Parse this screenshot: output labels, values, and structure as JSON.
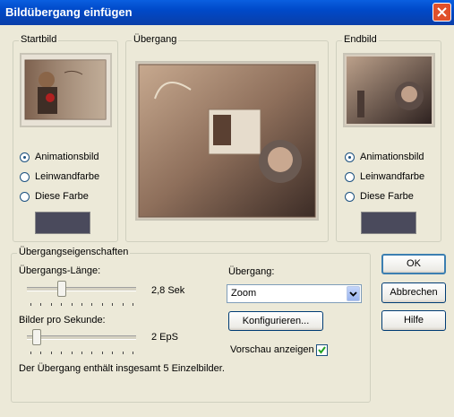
{
  "dialog": {
    "title": "Bildübergang einfügen"
  },
  "startbild": {
    "legend": "Startbild",
    "preview_alt": "Startbild-Vorschau",
    "options": [
      {
        "label": "Animationsbild",
        "selected": true
      },
      {
        "label": "Leinwandfarbe",
        "selected": false
      },
      {
        "label": "Diese Farbe",
        "selected": false
      }
    ],
    "color": "#4A4A5C"
  },
  "uebergang_preview": {
    "legend": "Übergang",
    "preview_alt": "Übergangs-Vorschau"
  },
  "endbild": {
    "legend": "Endbild",
    "preview_alt": "Endbild-Vorschau",
    "options": [
      {
        "label": "Animationsbild",
        "selected": true
      },
      {
        "label": "Leinwandfarbe",
        "selected": false
      },
      {
        "label": "Diese Farbe",
        "selected": false
      }
    ],
    "color": "#4A4A5C"
  },
  "properties": {
    "legend": "Übergangseigenschaften",
    "length_label": "Übergangs-Länge:",
    "length_value": "2,8 Sek",
    "length_fraction": 0.3,
    "fps_label": "Bilder pro Sekunde:",
    "fps_value": "2 EpS",
    "fps_fraction": 0.05,
    "transition_label": "Übergang:",
    "transition_value": "Zoom",
    "configure_label": "Konfigurieren...",
    "preview_label": "Vorschau anzeigen",
    "preview_checked": true,
    "summary": "Der Übergang enthält insgesamt 5 Einzelbilder."
  },
  "buttons": {
    "ok": "OK",
    "cancel": "Abbrechen",
    "help": "Hilfe"
  }
}
